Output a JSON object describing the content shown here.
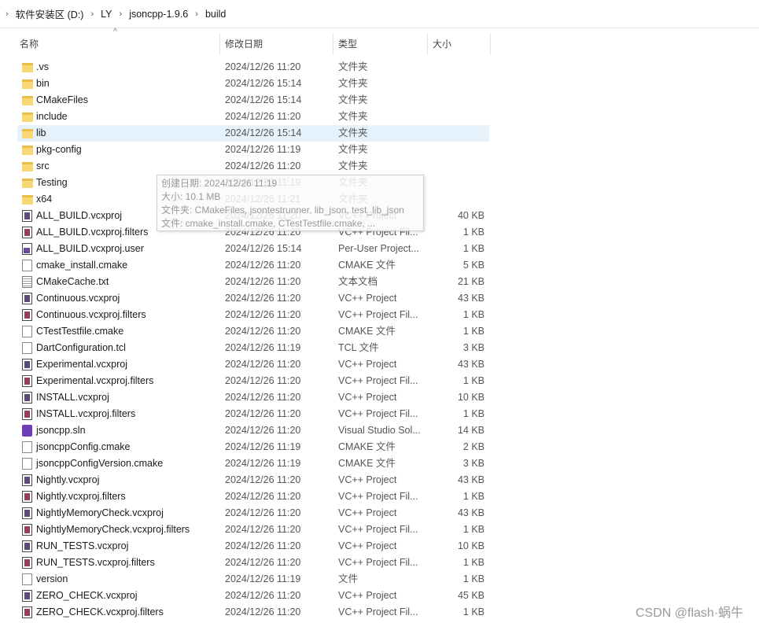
{
  "breadcrumb": [
    "软件安装区 (D:)",
    "LY",
    "jsoncpp-1.9.6",
    "build"
  ],
  "columns": {
    "name": "名称",
    "date": "修改日期",
    "type": "类型",
    "size": "大小"
  },
  "sort_arrow": "^",
  "files": [
    {
      "name": ".vs",
      "date": "2024/12/26 11:20",
      "type": "文件夹",
      "size": "",
      "icon": "folder-icon"
    },
    {
      "name": "bin",
      "date": "2024/12/26 15:14",
      "type": "文件夹",
      "size": "",
      "icon": "folder-icon"
    },
    {
      "name": "CMakeFiles",
      "date": "2024/12/26 15:14",
      "type": "文件夹",
      "size": "",
      "icon": "folder-icon"
    },
    {
      "name": "include",
      "date": "2024/12/26 11:20",
      "type": "文件夹",
      "size": "",
      "icon": "folder-icon"
    },
    {
      "name": "lib",
      "date": "2024/12/26 15:14",
      "type": "文件夹",
      "size": "",
      "icon": "folder-icon",
      "selected": true
    },
    {
      "name": "pkg-config",
      "date": "2024/12/26 11:19",
      "type": "文件夹",
      "size": "",
      "icon": "folder-icon"
    },
    {
      "name": "src",
      "date": "2024/12/26 11:20",
      "type": "文件夹",
      "size": "",
      "icon": "folder-icon"
    },
    {
      "name": "Testing",
      "date": "2024/12/26 11:19",
      "type": "文件夹",
      "size": "",
      "icon": "folder-icon"
    },
    {
      "name": "x64",
      "date": "2024/12/26 11:21",
      "type": "文件夹",
      "size": "",
      "icon": "folder-icon"
    },
    {
      "name": "ALL_BUILD.vcxproj",
      "date": "2024/12/26 11:20",
      "type": "VC++ Project",
      "size": "40 KB",
      "icon": "vcxproj-icon"
    },
    {
      "name": "ALL_BUILD.vcxproj.filters",
      "date": "2024/12/26 11:20",
      "type": "VC++ Project Fil...",
      "size": "1 KB",
      "icon": "filters-icon"
    },
    {
      "name": "ALL_BUILD.vcxproj.user",
      "date": "2024/12/26 15:14",
      "type": "Per-User Project...",
      "size": "1 KB",
      "icon": "user-file-icon"
    },
    {
      "name": "cmake_install.cmake",
      "date": "2024/12/26 11:20",
      "type": "CMAKE 文件",
      "size": "5 KB",
      "icon": "file-icon"
    },
    {
      "name": "CMakeCache.txt",
      "date": "2024/12/26 11:20",
      "type": "文本文档",
      "size": "21 KB",
      "icon": "text-file-icon"
    },
    {
      "name": "Continuous.vcxproj",
      "date": "2024/12/26 11:20",
      "type": "VC++ Project",
      "size": "43 KB",
      "icon": "vcxproj-icon"
    },
    {
      "name": "Continuous.vcxproj.filters",
      "date": "2024/12/26 11:20",
      "type": "VC++ Project Fil...",
      "size": "1 KB",
      "icon": "filters-icon"
    },
    {
      "name": "CTestTestfile.cmake",
      "date": "2024/12/26 11:20",
      "type": "CMAKE 文件",
      "size": "1 KB",
      "icon": "file-icon"
    },
    {
      "name": "DartConfiguration.tcl",
      "date": "2024/12/26 11:19",
      "type": "TCL 文件",
      "size": "3 KB",
      "icon": "file-icon"
    },
    {
      "name": "Experimental.vcxproj",
      "date": "2024/12/26 11:20",
      "type": "VC++ Project",
      "size": "43 KB",
      "icon": "vcxproj-icon"
    },
    {
      "name": "Experimental.vcxproj.filters",
      "date": "2024/12/26 11:20",
      "type": "VC++ Project Fil...",
      "size": "1 KB",
      "icon": "filters-icon"
    },
    {
      "name": "INSTALL.vcxproj",
      "date": "2024/12/26 11:20",
      "type": "VC++ Project",
      "size": "10 KB",
      "icon": "vcxproj-icon"
    },
    {
      "name": "INSTALL.vcxproj.filters",
      "date": "2024/12/26 11:20",
      "type": "VC++ Project Fil...",
      "size": "1 KB",
      "icon": "filters-icon"
    },
    {
      "name": "jsoncpp.sln",
      "date": "2024/12/26 11:20",
      "type": "Visual Studio Sol...",
      "size": "14 KB",
      "icon": "sln-icon"
    },
    {
      "name": "jsoncppConfig.cmake",
      "date": "2024/12/26 11:19",
      "type": "CMAKE 文件",
      "size": "2 KB",
      "icon": "file-icon"
    },
    {
      "name": "jsoncppConfigVersion.cmake",
      "date": "2024/12/26 11:19",
      "type": "CMAKE 文件",
      "size": "3 KB",
      "icon": "file-icon"
    },
    {
      "name": "Nightly.vcxproj",
      "date": "2024/12/26 11:20",
      "type": "VC++ Project",
      "size": "43 KB",
      "icon": "vcxproj-icon"
    },
    {
      "name": "Nightly.vcxproj.filters",
      "date": "2024/12/26 11:20",
      "type": "VC++ Project Fil...",
      "size": "1 KB",
      "icon": "filters-icon"
    },
    {
      "name": "NightlyMemoryCheck.vcxproj",
      "date": "2024/12/26 11:20",
      "type": "VC++ Project",
      "size": "43 KB",
      "icon": "vcxproj-icon"
    },
    {
      "name": "NightlyMemoryCheck.vcxproj.filters",
      "date": "2024/12/26 11:20",
      "type": "VC++ Project Fil...",
      "size": "1 KB",
      "icon": "filters-icon"
    },
    {
      "name": "RUN_TESTS.vcxproj",
      "date": "2024/12/26 11:20",
      "type": "VC++ Project",
      "size": "10 KB",
      "icon": "vcxproj-icon"
    },
    {
      "name": "RUN_TESTS.vcxproj.filters",
      "date": "2024/12/26 11:20",
      "type": "VC++ Project Fil...",
      "size": "1 KB",
      "icon": "filters-icon"
    },
    {
      "name": "version",
      "date": "2024/12/26 11:19",
      "type": "文件",
      "size": "1 KB",
      "icon": "file-icon"
    },
    {
      "name": "ZERO_CHECK.vcxproj",
      "date": "2024/12/26 11:20",
      "type": "VC++ Project",
      "size": "45 KB",
      "icon": "vcxproj-icon"
    },
    {
      "name": "ZERO_CHECK.vcxproj.filters",
      "date": "2024/12/26 11:20",
      "type": "VC++ Project Fil...",
      "size": "1 KB",
      "icon": "filters-icon"
    }
  ],
  "tooltip": {
    "created": "创建日期: 2024/12/26 11:19",
    "size": "大小: 10.1 MB",
    "folders": "文件夹: CMakeFiles, jsontestrunner, lib_json, test_lib_json",
    "files": "文件: cmake_install.cmake, CTestTestfile.cmake, ..."
  },
  "watermark": "CSDN @flash·蜗牛"
}
